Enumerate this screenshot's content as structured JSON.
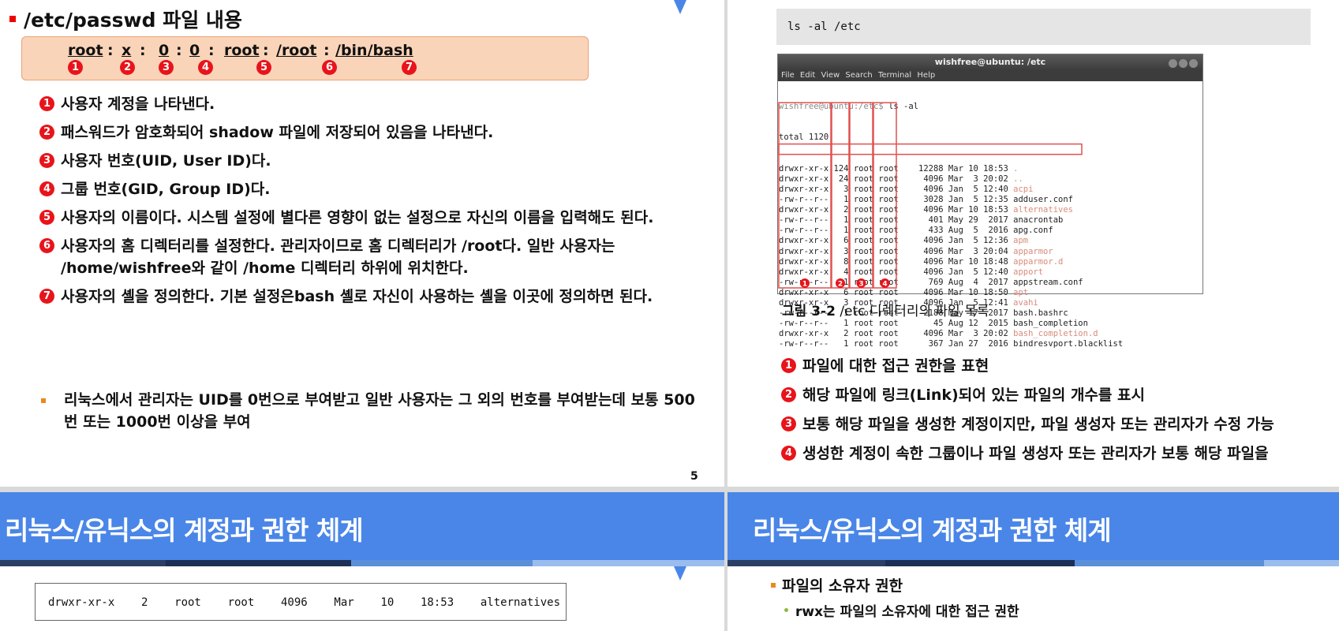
{
  "slide1": {
    "heading": "/etc/passwd 파일 내용",
    "passwd_fields": [
      "root",
      "x",
      "0",
      "0",
      "root",
      "/root",
      "/bin/bash"
    ],
    "separator": ":",
    "field_numbers": [
      "1",
      "2",
      "3",
      "4",
      "5",
      "6",
      "7"
    ],
    "items": [
      {
        "num": "1",
        "text": "사용자 계정을 나타낸다."
      },
      {
        "num": "2",
        "text": "패스워드가 암호화되어 shadow 파일에 저장되어 있음을 나타낸다."
      },
      {
        "num": "3",
        "text": "사용자 번호(UID, User ID)다."
      },
      {
        "num": "4",
        "text": "그룹 번호(GID, Group ID)다."
      },
      {
        "num": "5",
        "text": "사용자의 이름이다. 시스템 설정에 별다른 영향이 없는 설정으로 자신의 이름을 입력해도 된다."
      },
      {
        "num": "6",
        "text": "사용자의 홈 디렉터리를 설정한다. 관리자이므로 홈 디렉터리가 /root다. 일반 사용자는 /home/wishfree와 같이 /home 디렉터리 하위에 위치한다."
      },
      {
        "num": "7",
        "text": "사용자의 셸을 정의한다. 기본 설정은bash 셸로 자신이 사용하는 셸을 이곳에 정의하면 된다."
      }
    ],
    "note": "리눅스에서 관리자는 UID를 0번으로 부여받고 일반 사용자는 그 외의 번호를 부여받는데 보통 500번 또는 1000번 이상을 부여",
    "page_number": "5"
  },
  "slide2": {
    "command": "ls  -al /etc",
    "terminal": {
      "title": "wishfree@ubuntu: /etc",
      "menu": [
        "File",
        "Edit",
        "View",
        "Search",
        "Terminal",
        "Help"
      ],
      "prompt": "wishfree@ubuntu:/etc$",
      "prompt_cmd": " ls -al",
      "total": "total 1120",
      "rows": [
        {
          "perm": "drwxr-xr-x",
          "links": "124",
          "owner": "root",
          "group": "root",
          "size": "12288",
          "date": "Mar 10 18:53",
          "name": ".",
          "dir": true
        },
        {
          "perm": "drwxr-xr-x",
          "links": "24",
          "owner": "root",
          "group": "root",
          "size": "4096",
          "date": "Mar  3 20:02",
          "name": "..",
          "dir": true
        },
        {
          "perm": "drwxr-xr-x",
          "links": "3",
          "owner": "root",
          "group": "root",
          "size": "4096",
          "date": "Jan  5 12:40",
          "name": "acpi",
          "dir": true
        },
        {
          "perm": "-rw-r--r--",
          "links": "1",
          "owner": "root",
          "group": "root",
          "size": "3028",
          "date": "Jan  5 12:35",
          "name": "adduser.conf",
          "dir": false
        },
        {
          "perm": "drwxr-xr-x",
          "links": "2",
          "owner": "root",
          "group": "root",
          "size": "4096",
          "date": "Mar 10 18:53",
          "name": "alternatives",
          "dir": true,
          "highlight": true
        },
        {
          "perm": "-rw-r--r--",
          "links": "1",
          "owner": "root",
          "group": "root",
          "size": "401",
          "date": "May 29  2017",
          "name": "anacrontab",
          "dir": false
        },
        {
          "perm": "-rw-r--r--",
          "links": "1",
          "owner": "root",
          "group": "root",
          "size": "433",
          "date": "Aug  5  2016",
          "name": "apg.conf",
          "dir": false
        },
        {
          "perm": "drwxr-xr-x",
          "links": "6",
          "owner": "root",
          "group": "root",
          "size": "4096",
          "date": "Jan  5 12:36",
          "name": "apm",
          "dir": true
        },
        {
          "perm": "drwxr-xr-x",
          "links": "3",
          "owner": "root",
          "group": "root",
          "size": "4096",
          "date": "Mar  3 20:04",
          "name": "apparmor",
          "dir": true
        },
        {
          "perm": "drwxr-xr-x",
          "links": "8",
          "owner": "root",
          "group": "root",
          "size": "4096",
          "date": "Mar 10 18:48",
          "name": "apparmor.d",
          "dir": true
        },
        {
          "perm": "drwxr-xr-x",
          "links": "4",
          "owner": "root",
          "group": "root",
          "size": "4096",
          "date": "Jan  5 12:40",
          "name": "apport",
          "dir": true
        },
        {
          "perm": "-rw-r--r--",
          "links": "1",
          "owner": "root",
          "group": "root",
          "size": "769",
          "date": "Aug  4  2017",
          "name": "appstream.conf",
          "dir": false
        },
        {
          "perm": "drwxr-xr-x",
          "links": "6",
          "owner": "root",
          "group": "root",
          "size": "4096",
          "date": "Mar 10 18:50",
          "name": "apt",
          "dir": true
        },
        {
          "perm": "drwxr-xr-x",
          "links": "3",
          "owner": "root",
          "group": "root",
          "size": "4096",
          "date": "Jan  5 12:41",
          "name": "avahi",
          "dir": true
        },
        {
          "perm": "-rw-r--r--",
          "links": "1",
          "owner": "root",
          "group": "root",
          "size": "2188",
          "date": "May 17  2017",
          "name": "bash.bashrc",
          "dir": false
        },
        {
          "perm": "-rw-r--r--",
          "links": "1",
          "owner": "root",
          "group": "root",
          "size": "45",
          "date": "Aug 12  2015",
          "name": "bash_completion",
          "dir": false
        },
        {
          "perm": "drwxr-xr-x",
          "links": "2",
          "owner": "root",
          "group": "root",
          "size": "4096",
          "date": "Mar  3 20:02",
          "name": "bash_completion.d",
          "dir": true
        },
        {
          "perm": "-rw-r--r--",
          "links": "1",
          "owner": "root",
          "group": "root",
          "size": "367",
          "date": "Jan 27  2016",
          "name": "bindresvport.blacklist",
          "dir": false
        }
      ]
    },
    "caption_bold": "그림 3-2",
    "caption_text": " /etc 디렉터리의 파일 목록",
    "items": [
      {
        "num": "1",
        "text": "파일에 대한 접근 권한을 표현"
      },
      {
        "num": "2",
        "text": "해당 파일에 링크(Link)되어 있는 파일의 개수를 표시"
      },
      {
        "num": "3",
        "text": "보통 해당 파일을 생성한 계정이지만, 파일 생성자 또는 관리자가 수정 가능"
      },
      {
        "num": "4",
        "text": "생성한 계정이 속한 그룹이나 파일 생성자 또는 관리자가 보통 해당 파일을"
      }
    ]
  },
  "slide3": {
    "title": "리눅스/유닉스의 계정과 권한 체계",
    "ls_line": "drwxr-xr-x    2    root    root    4096    Mar    10    18:53    alternatives"
  },
  "slide4": {
    "title": "리눅스/유닉스의 계정과 권한 체계",
    "bullet1": "파일의 소유자 권한",
    "bullet2": "rwx는 파일의 소유자에 대한 접근 권한"
  },
  "colors": {
    "banner_blue": "#4a86e8",
    "number_red": "#e8141b",
    "bullet_orange": "#e88a1e",
    "highlight_red": "#e05050"
  }
}
